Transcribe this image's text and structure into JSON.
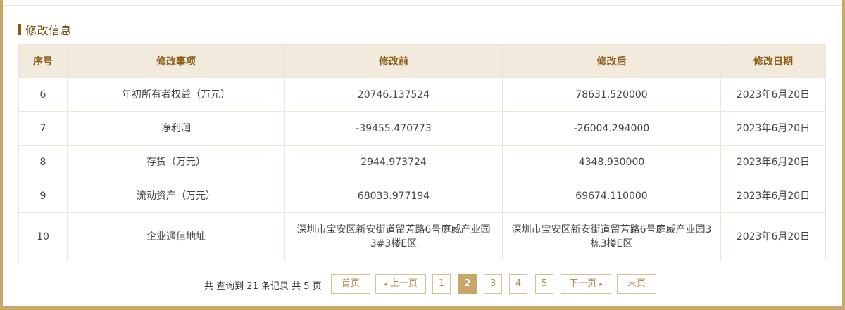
{
  "section": {
    "title": "修改信息"
  },
  "table": {
    "headers": {
      "index": "序号",
      "item": "修改事项",
      "before": "修改前",
      "after": "修改后",
      "date": "修改日期"
    },
    "rows": [
      {
        "index": "6",
        "item": "年初所有者权益（万元）",
        "before": "20746.137524",
        "after": "78631.520000",
        "date": "2023年6月20日"
      },
      {
        "index": "7",
        "item": "净利润",
        "before": "-39455.470773",
        "after": "-26004.294000",
        "date": "2023年6月20日"
      },
      {
        "index": "8",
        "item": "存货（万元）",
        "before": "2944.973724",
        "after": "4348.930000",
        "date": "2023年6月20日"
      },
      {
        "index": "9",
        "item": "流动资产（万元）",
        "before": "68033.977194",
        "after": "69674.110000",
        "date": "2023年6月20日"
      },
      {
        "index": "10",
        "item": "企业通信地址",
        "before": "深圳市宝安区新安街道留芳路6号庭威产业园3#3楼E区",
        "after": "深圳市宝安区新安街道留芳路6号庭威产业园3栋3楼E区",
        "date": "2023年6月20日"
      }
    ]
  },
  "pagination": {
    "summary": "共 查询到 21 条记录 共 5 页",
    "first": "首页",
    "prev": "上一页",
    "prev_icon": "◂",
    "pages": [
      "1",
      "2",
      "3",
      "4",
      "5"
    ],
    "current_page": "2",
    "next": "下一页",
    "next_icon": "▸",
    "last": "末页",
    "accent_color": "#c8a768"
  }
}
